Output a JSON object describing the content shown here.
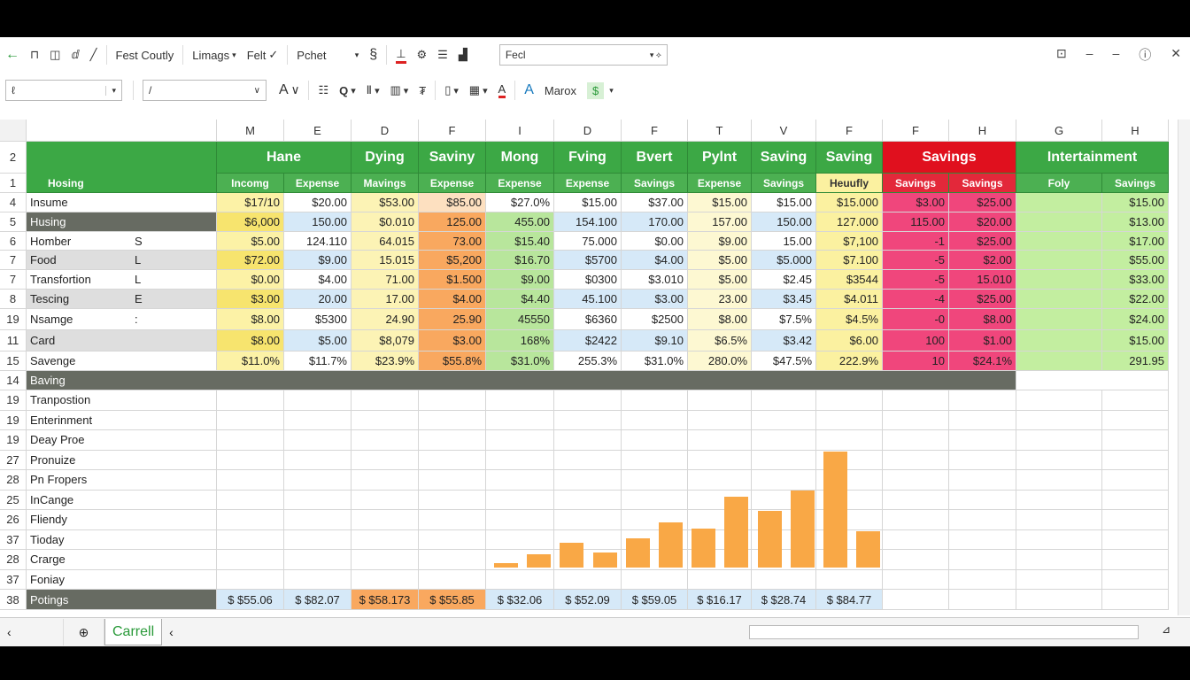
{
  "toolbar1": {
    "items": [
      "Fest Coutly",
      "Limags",
      "Felt",
      "Pchet"
    ],
    "font_box": "Fecl"
  },
  "toolbar2": {
    "name_box": "ℓ",
    "formula_box": "/",
    "style_label": "Marox",
    "currency": "$"
  },
  "colors": {
    "green_header": "#3ca845",
    "red_header": "#e0101e",
    "pink": "#f0467c",
    "orange": "#f9a85f",
    "bar": "#f9a846",
    "dark_row": "#676b62"
  },
  "column_letters": [
    "M",
    "E",
    "D",
    "F",
    "I",
    "D",
    "F",
    "T",
    "V",
    "F",
    "F",
    "H",
    "G",
    "H"
  ],
  "header": {
    "row2_num": "2",
    "row1_num": "1",
    "corner_label": "Hosing",
    "groups": [
      {
        "label": "Hane",
        "span": 2
      },
      {
        "label": "Dying",
        "span": 1
      },
      {
        "label": "Saviny",
        "span": 1
      },
      {
        "label": "Mong",
        "span": 1
      },
      {
        "label": "Fving",
        "span": 1
      },
      {
        "label": "Bvert",
        "span": 1
      },
      {
        "label": "Pylnt",
        "span": 1
      },
      {
        "label": "Saving",
        "span": 1
      },
      {
        "label": "Saving",
        "span": 1
      },
      {
        "label": "Savings",
        "span": 2,
        "color": "red"
      },
      {
        "label": "Intertainment",
        "span": 2
      }
    ],
    "sub": [
      "Incomg",
      "Expense",
      "Mavings",
      "Expense",
      "Expense",
      "Expense",
      "Savings",
      "Expense",
      "Savings",
      "Heuufly",
      "Savings",
      "Savings",
      "Foly",
      "Savings"
    ]
  },
  "rows": [
    {
      "num": "4",
      "label": "Insume",
      "sub": "",
      "values": [
        "$17/10",
        "$20.00",
        "$53.00",
        "$85.00",
        "$27.0%",
        "$15.00",
        "$37.00",
        "$15.00",
        "$15.00",
        "$15.000",
        "$3.00",
        "$25.00",
        "",
        "$15.00"
      ]
    },
    {
      "num": "5",
      "label": "Husing",
      "sub": "",
      "style": "dark",
      "values": [
        "$6,000",
        "150.00",
        "$0.010",
        "125.00",
        "455.00",
        "154.100",
        "170.00",
        "157.00",
        "150.00",
        "127.000",
        "115.00",
        "$20.00",
        "",
        "$13.00"
      ]
    },
    {
      "num": "6",
      "label": "Homber",
      "sub": "S",
      "values": [
        "$5.00",
        "124.110",
        "64.015",
        "73.00",
        "$15.40",
        "75.000",
        "$0.00",
        "$9.00",
        "15.00",
        "$7,100",
        "-1",
        "$25.00",
        "",
        "$17.00"
      ]
    },
    {
      "num": "7",
      "label": "Food",
      "sub": "L",
      "style": "gray",
      "values": [
        "$72.00",
        "$9.00",
        "15.015",
        "$5,200",
        "$16.70",
        "$5700",
        "$4.00",
        "$5.00",
        "$5.000",
        "$7.100",
        "-5",
        "$2.00",
        "",
        "$55.00"
      ]
    },
    {
      "num": "7",
      "label": "Transfortion",
      "sub": "L",
      "values": [
        "$0.00",
        "$4.00",
        "71.00",
        "$1.500",
        "$9.00",
        "$0300",
        "$3.010",
        "$5.00",
        "$2.45",
        "$3544",
        "-5",
        "15.010",
        "",
        "$33.00"
      ]
    },
    {
      "num": "8",
      "label": "Tescing",
      "sub": "E",
      "style": "gray",
      "values": [
        "$3.00",
        "20.00",
        "17.00",
        "$4.00",
        "$4.40",
        "45.100",
        "$3.00",
        "23.00",
        "$3.45",
        "$4.011",
        "-4",
        "$25.00",
        "",
        "$22.00"
      ]
    },
    {
      "num": "19",
      "label": "Nsamge",
      "sub": ":",
      "values": [
        "$8.00",
        "$5300",
        "24.90",
        "25.90",
        "45550",
        "$6360",
        "$2500",
        "$8.00",
        "$7.5%",
        "$4.5%",
        "-0",
        "$8.00",
        "",
        "$24.00"
      ]
    },
    {
      "num": "11",
      "label": "Card",
      "sub": "",
      "style": "gray",
      "values": [
        "$8.00",
        "$5.00",
        "$8,079",
        "$3.00",
        "168%",
        "$2422",
        "$9.10",
        "$6.5%",
        "$3.42",
        "$6.00",
        "100",
        "$1.00",
        "",
        "$15.00"
      ]
    },
    {
      "num": "15",
      "label": "Savenge",
      "sub": "",
      "values": [
        "$11.0%",
        "$11.7%",
        "$23.9%",
        "$55.8%",
        "$31.0%",
        "255.3%",
        "$31.0%",
        "280.0%",
        "$47.5%",
        "222.9%",
        "10",
        "$24.1%",
        "",
        "291.95"
      ]
    }
  ],
  "section_row": {
    "num": "14",
    "label": "Baving"
  },
  "lower_rows": [
    {
      "num": "19",
      "label": "Tranpostion"
    },
    {
      "num": "19",
      "label": "Enterinment"
    },
    {
      "num": "19",
      "label": "Deay Proe"
    },
    {
      "num": "27",
      "label": "Pronuize"
    },
    {
      "num": "28",
      "label": "Pn Fropers"
    },
    {
      "num": "25",
      "label": "InCange"
    },
    {
      "num": "26",
      "label": "Fliendy"
    },
    {
      "num": "37",
      "label": "Tioday"
    },
    {
      "num": "28",
      "label": "Crarge"
    },
    {
      "num": "37",
      "label": "Foniay"
    }
  ],
  "totals_row": {
    "num": "38",
    "label": "Potings",
    "values": [
      "$ $55.06",
      "$ $82.07",
      "$ $58.173",
      "$ $55.85",
      "$ $32.06",
      "$ $52.09",
      "$ $59.05",
      "$ $16.17",
      "$ $28.74",
      "$ $84.77"
    ]
  },
  "chart_bars": {
    "type": "bar",
    "values": [
      5,
      15,
      28,
      17,
      33,
      51,
      44,
      80,
      64,
      87,
      131,
      41
    ]
  },
  "sheet_tabs": {
    "active": "Carrell"
  }
}
